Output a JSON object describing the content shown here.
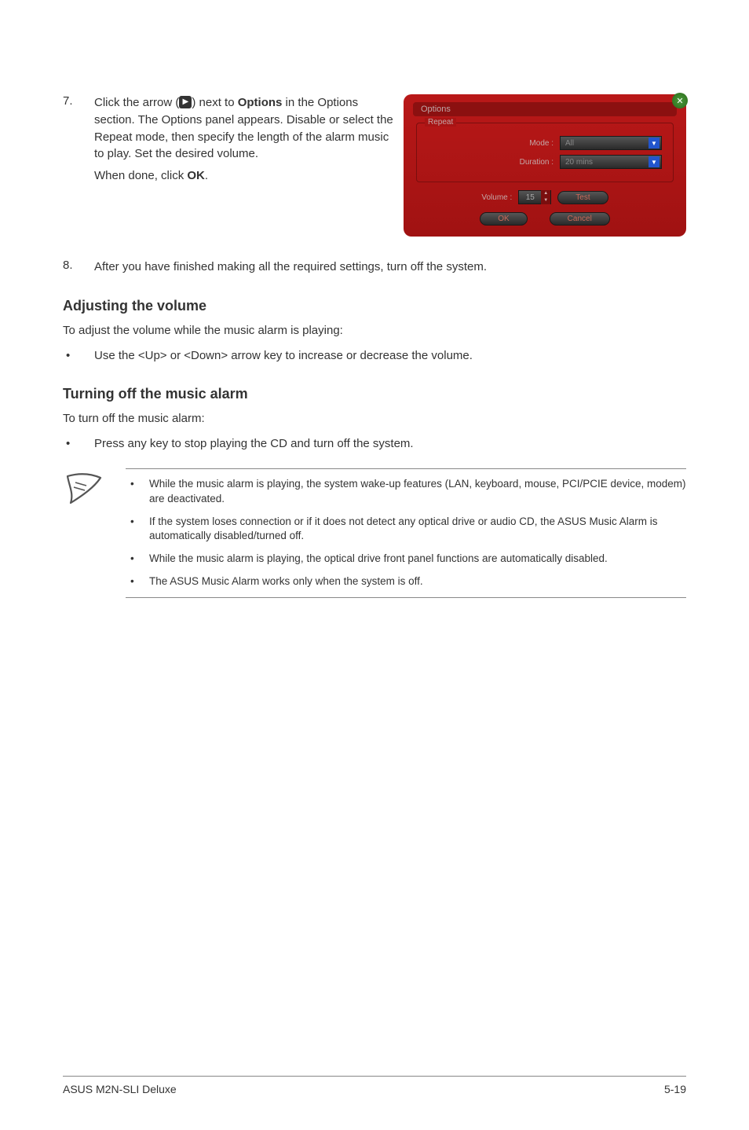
{
  "step7": {
    "num": "7.",
    "line1a": "Click the arrow (",
    "line1b": ") next to ",
    "line1c": "Options",
    "rest": " in the Options section. The Options panel appears. Disable or select the Repeat mode, then specify the length of the alarm music to play. Set the desired volume.",
    "line2a": "When done, click ",
    "line2b": "OK",
    "line2c": "."
  },
  "optionsPanel": {
    "title": "Options",
    "legend": "Repeat",
    "modeLabel": "Mode :",
    "modeValue": "All",
    "durationLabel": "Duration :",
    "durationValue": "20 mins",
    "volumeLabel": "Volume :",
    "volumeValue": "15",
    "testBtn": "Test",
    "okBtn": "OK",
    "cancelBtn": "Cancel"
  },
  "step8": {
    "num": "8.",
    "text": "After you have finished making all the required settings, turn off the system."
  },
  "adjust": {
    "heading": "Adjusting the volume",
    "intro": "To adjust the volume while the music alarm is playing:",
    "bullet": "Use the  <Up> or <Down> arrow key to increase or decrease the volume."
  },
  "turnoff": {
    "heading": "Turning off the music alarm",
    "intro": "To turn off the music alarm:",
    "bullet": "Press any key to stop playing the CD and turn off the system."
  },
  "notes": {
    "n1": "While the music alarm is playing, the system wake-up features (LAN, keyboard, mouse, PCI/PCIE device, modem) are deactivated.",
    "n2": "If the system loses connection or if it does not detect any optical drive or audio CD, the ASUS Music Alarm is automatically disabled/turned off.",
    "n3": "While the music alarm is playing, the optical drive front panel functions are automatically disabled.",
    "n4": "The ASUS Music Alarm works only when the system is off."
  },
  "footer": {
    "left": "ASUS M2N-SLI Deluxe",
    "right": "5-19"
  }
}
